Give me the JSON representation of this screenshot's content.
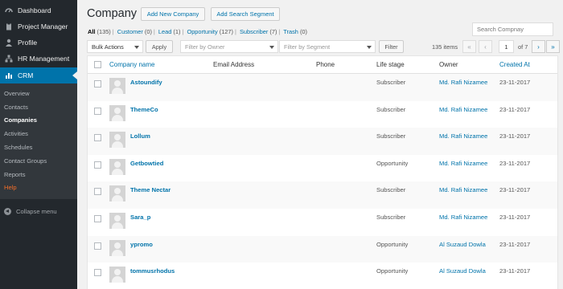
{
  "sidebar": {
    "menu": [
      {
        "label": "Dashboard",
        "icon": "dashboard-icon"
      },
      {
        "label": "Project Manager",
        "icon": "clipboard-icon"
      },
      {
        "label": "Profile",
        "icon": "user-icon"
      },
      {
        "label": "HR Management",
        "icon": "tree-icon"
      },
      {
        "label": "CRM",
        "icon": "chart-icon",
        "active": true
      }
    ],
    "submenu": [
      {
        "label": "Overview"
      },
      {
        "label": "Contacts"
      },
      {
        "label": "Companies",
        "current": true
      },
      {
        "label": "Activities"
      },
      {
        "label": "Schedules"
      },
      {
        "label": "Contact Groups"
      },
      {
        "label": "Reports"
      },
      {
        "label": "Help"
      }
    ],
    "collapse_label": "Collapse menu"
  },
  "header": {
    "title": "Company",
    "add_new_label": "Add New Company",
    "add_segment_label": "Add Search Segment",
    "search_placeholder": "Search Compnay"
  },
  "views": {
    "all_label": "All",
    "all_count": "(135)",
    "customer_label": "Customer",
    "customer_count": "(0)",
    "lead_label": "Lead",
    "lead_count": "(1)",
    "opportunity_label": "Opportunity",
    "opportunity_count": "(127)",
    "subscriber_label": "Subscriber",
    "subscriber_count": "(7)",
    "trash_label": "Trash",
    "trash_count": "(0)"
  },
  "filters": {
    "bulk_actions": "Bulk Actions",
    "apply_label": "Apply",
    "owner_placeholder": "Filter by Owner",
    "segment_placeholder": "Filter by Segment",
    "filter_label": "Filter"
  },
  "pagination": {
    "items": "135 items",
    "first": "«",
    "prev": "‹",
    "current_page": "1",
    "of_label": "of 7",
    "next": "›",
    "last": "»"
  },
  "table": {
    "headers": {
      "company_name": "Company name",
      "email": "Email Address",
      "phone": "Phone",
      "life_stage": "Life stage",
      "owner": "Owner",
      "created_at": "Created At"
    },
    "rows": [
      {
        "name": "Astoundify",
        "email": "",
        "phone": "",
        "stage": "Subscriber",
        "owner": "Md. Rafi Nizamee",
        "date": "23-11-2017"
      },
      {
        "name": "ThemeCo",
        "email": "",
        "phone": "",
        "stage": "Subscriber",
        "owner": "Md. Rafi Nizamee",
        "date": "23-11-2017"
      },
      {
        "name": "Lollum",
        "email": "",
        "phone": "",
        "stage": "Subscriber",
        "owner": "Md. Rafi Nizamee",
        "date": "23-11-2017"
      },
      {
        "name": "Getbowtied",
        "email": "",
        "phone": "",
        "stage": "Opportunity",
        "owner": "Md. Rafi Nizamee",
        "date": "23-11-2017"
      },
      {
        "name": "Theme Nectar",
        "email": "",
        "phone": "",
        "stage": "Subscriber",
        "owner": "Md. Rafi Nizamee",
        "date": "23-11-2017"
      },
      {
        "name": "Sara_p",
        "email": "",
        "phone": "",
        "stage": "Subscriber",
        "owner": "Md. Rafi Nizamee",
        "date": "23-11-2017"
      },
      {
        "name": "ypromo",
        "email": "",
        "phone": "",
        "stage": "Opportunity",
        "owner": "Al Suzaud Dowla",
        "date": "23-11-2017"
      },
      {
        "name": "tommusrhodus",
        "email": "",
        "phone": "",
        "stage": "Opportunity",
        "owner": "Al Suzaud Dowla",
        "date": "23-11-2017"
      }
    ]
  },
  "colors": {
    "accent": "#0073aa",
    "sidebar_bg": "#23282d",
    "help": "#f56e28"
  }
}
